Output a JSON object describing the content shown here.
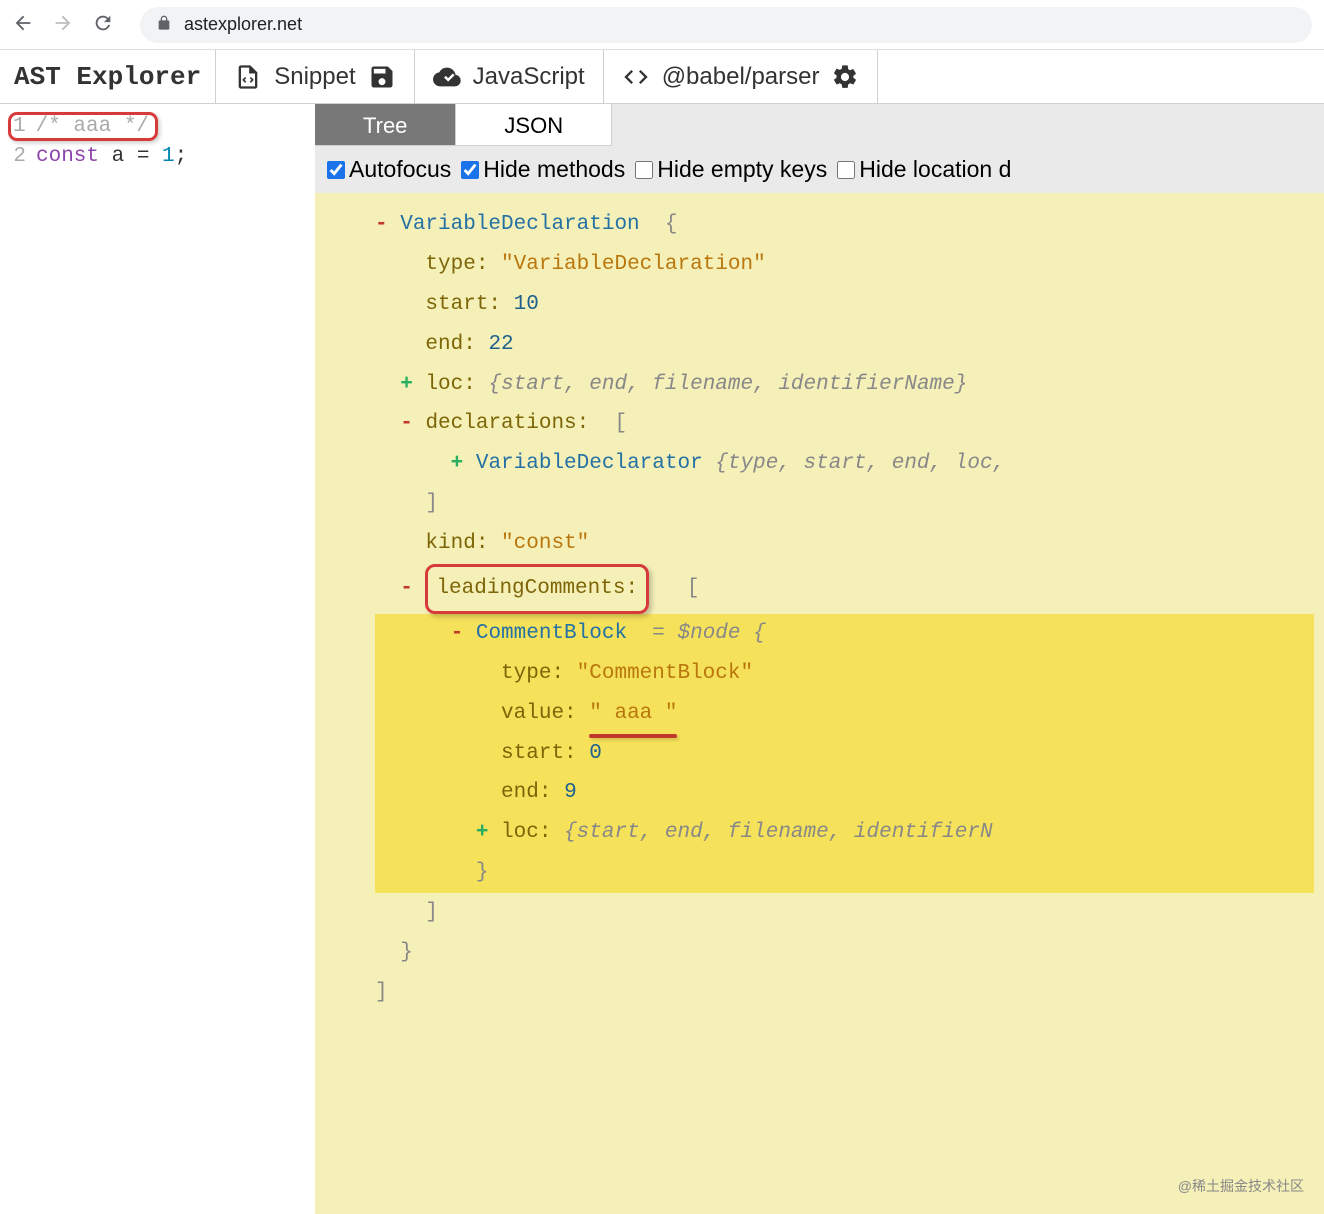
{
  "browser": {
    "url": "astexplorer.net"
  },
  "app": {
    "title": "AST Explorer"
  },
  "toolbar": {
    "snippet": "Snippet",
    "language": "JavaScript",
    "parser": "@babel/parser"
  },
  "code": {
    "lines": [
      {
        "n": "1",
        "content": "/* aaa */",
        "cls": "tok-comment",
        "hl": true
      },
      {
        "n": "2",
        "tokens": [
          {
            "t": "const",
            "c": "tok-keyword"
          },
          {
            "t": " a ",
            "c": "tok-var"
          },
          {
            "t": "=",
            "c": "tok-op"
          },
          {
            "t": " 1",
            "c": "tok-num"
          },
          {
            "t": ";",
            "c": "tok-op"
          }
        ]
      }
    ]
  },
  "tabs": {
    "tree": "Tree",
    "json": "JSON"
  },
  "options": {
    "autofocus": "Autofocus",
    "hide_methods": "Hide methods",
    "hide_empty": "Hide empty keys",
    "hide_location": "Hide location d"
  },
  "ast": {
    "node1": "VariableDeclaration",
    "type_lbl": "type:",
    "type_val": "\"VariableDeclaration\"",
    "start_lbl": "start:",
    "start_val": "10",
    "end_lbl": "end:",
    "end_val": "22",
    "loc_lbl": "loc:",
    "loc_summary": "{start, end, filename, identifierName}",
    "decl_lbl": "declarations:",
    "decl_node": "VariableDeclarator",
    "decl_summary": "{type, start, end, loc,",
    "kind_lbl": "kind:",
    "kind_val": "\"const\"",
    "lc_lbl": "leadingComments:",
    "cb_node": "CommentBlock",
    "cb_eq": "= $node {",
    "cb_type_lbl": "type:",
    "cb_type_val": "\"CommentBlock\"",
    "cb_value_lbl": "value:",
    "cb_value_val": "\" aaa \"",
    "cb_start_lbl": "start:",
    "cb_start_val": "0",
    "cb_end_lbl": "end:",
    "cb_end_val": "9",
    "cb_loc_lbl": "loc:",
    "cb_loc_summary": "{start, end, filename, identifierN"
  },
  "watermark": "@稀土掘金技术社区"
}
